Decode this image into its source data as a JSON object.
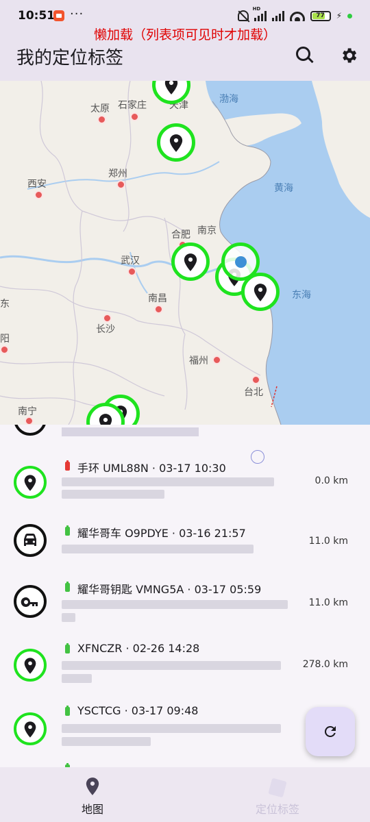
{
  "status": {
    "time": "10:51",
    "dots": "···",
    "battery": "77",
    "battery_fraction": 0.77
  },
  "header": {
    "banner": "懒加载（列表项可见时才加载）",
    "title": "我的定位标签"
  },
  "map": {
    "cities": [
      "太原",
      "石家庄",
      "天津",
      "郑州",
      "西安",
      "合肥",
      "南京",
      "武汉",
      "南昌",
      "长沙",
      "福州",
      "台北",
      "南宁",
      "东",
      "阳"
    ],
    "seas": [
      "渤海",
      "黄海",
      "东海"
    ]
  },
  "list": {
    "items": [
      {
        "battery_color": "#e53935",
        "title": "手环 UML88N · 03-17 10:30",
        "distance": "0.0 km",
        "icon": "pin-icon"
      },
      {
        "battery_color": "#43c243",
        "title": "耀华哥车 O9PDYE · 03-16 21:57",
        "distance": "11.0 km",
        "icon": "car-icon"
      },
      {
        "battery_color": "#43c243",
        "title": "耀华哥钥匙 VMNG5A · 03-17 05:59",
        "distance": "11.0 km",
        "icon": "key-icon"
      },
      {
        "battery_color": "#43c243",
        "title": "XFNCZR · 02-26 14:28",
        "distance": "278.0 km",
        "icon": "pin-icon"
      },
      {
        "battery_color": "#43c243",
        "title": "YSCTCG · 03-17 09:48",
        "distance": "",
        "icon": "pin-icon"
      }
    ]
  },
  "nav": {
    "map_label": "地图",
    "tags_label": "定位标签"
  }
}
